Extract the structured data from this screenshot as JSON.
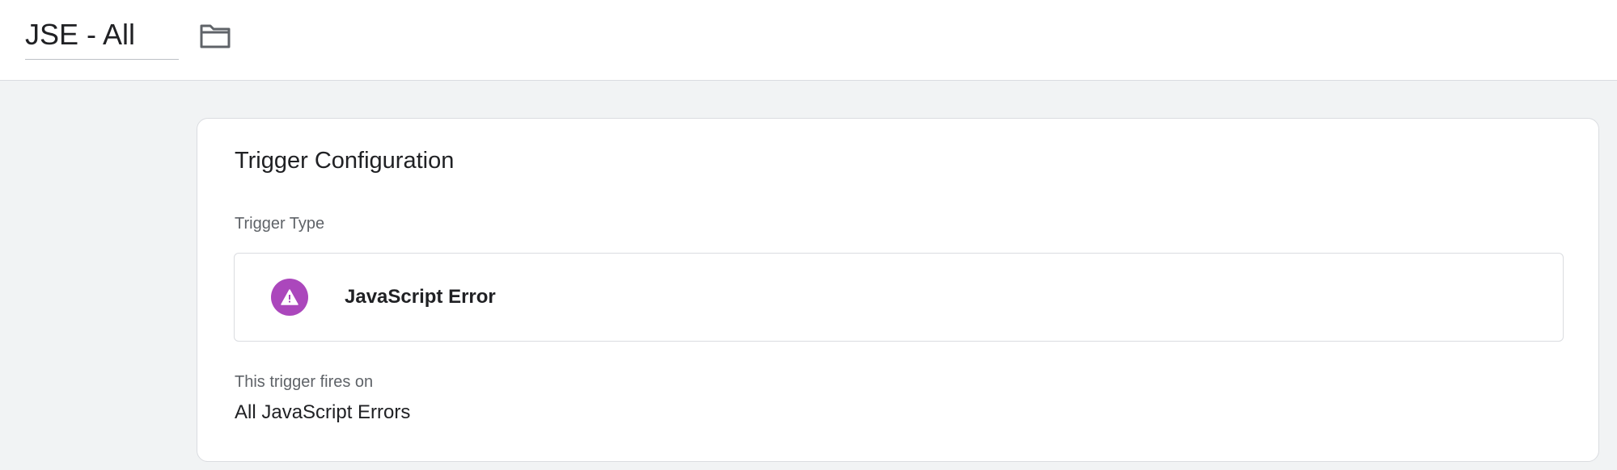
{
  "header": {
    "trigger_name": "JSE - All",
    "folder_icon": "folder-icon"
  },
  "card": {
    "title": "Trigger Configuration",
    "trigger_type_label": "Trigger Type",
    "trigger_type": {
      "name": "JavaScript Error",
      "icon": "warning-icon",
      "icon_color": "#ab47bc"
    },
    "fires_on_label": "This trigger fires on",
    "fires_on_value": "All JavaScript Errors"
  }
}
